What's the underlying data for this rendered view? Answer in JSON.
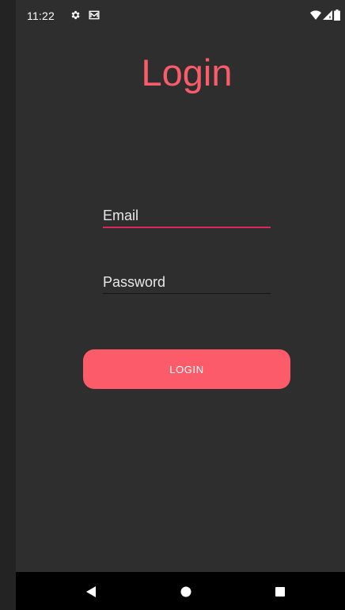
{
  "status_bar": {
    "time": "11:22",
    "icons": [
      "gear-icon",
      "mail-icon",
      "wifi-icon",
      "signal-icon",
      "battery-icon"
    ]
  },
  "title": "Login",
  "form": {
    "email_placeholder": "Email",
    "email_value": "",
    "password_placeholder": "Password",
    "password_value": "",
    "login_label": "LOGIN"
  },
  "nav_bar": {
    "icons": [
      "back-icon",
      "home-icon",
      "recents-icon"
    ]
  },
  "colors": {
    "accent": "#fc5c6a",
    "focus_underline": "#d8285e",
    "background": "#2e2e2e"
  }
}
